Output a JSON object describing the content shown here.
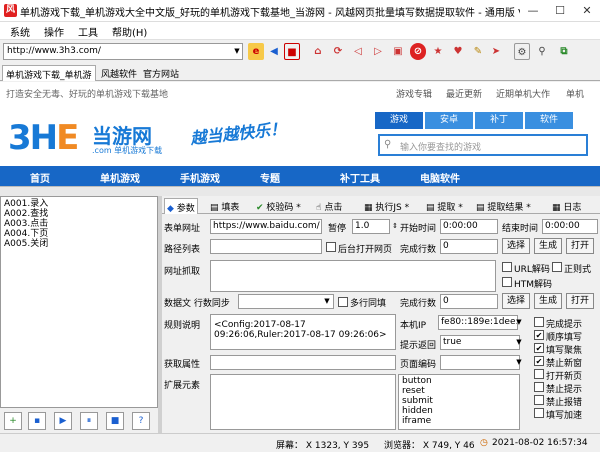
{
  "window": {
    "title": "单机游戏下载_单机游戏大全中文版_好玩的单机游戏下载基地_当游网 - 风越网页批量填写数据提取软件 - 通用版 V..."
  },
  "menu": [
    "系统",
    "操作",
    "工具",
    "帮助(H)"
  ],
  "toolbar": {
    "url": "http://www.3h3.com/"
  },
  "tabs": [
    "单机游戏下载_单机游",
    "风越软件",
    "官方网站"
  ],
  "browser": {
    "slogan": "打造安全无毒、好玩的单机游戏下载基地",
    "toplinks": [
      "游戏专辑",
      "最近更新",
      "近期单机大作",
      "单机"
    ],
    "logo_3": "3H",
    "logo_e": "E",
    "logo_text": "当游网",
    "logo_domain": ".com 单机游戏下载",
    "slogan2": "越当越快乐！",
    "search_tabs": [
      "游戏",
      "安卓",
      "补丁",
      "软件"
    ],
    "search_placeholder": "输入你要查找的游戏",
    "nav": [
      "首页",
      "单机游戏",
      "手机游戏",
      "专题",
      "补丁工具",
      "电脑软件"
    ]
  },
  "left_list": [
    "A001.录入",
    "A002.查找",
    "A003.点击",
    "A004.下页",
    "A005.关闭"
  ],
  "right_tabs": [
    "参数",
    "填表",
    "校验码",
    "点击",
    "执行JS",
    "提取",
    "提取结果",
    "日志"
  ],
  "form": {
    "form_url_label": "表单网址",
    "form_url": "https://www.baidu.com/",
    "pause_label": "暂停",
    "pause": "1.0",
    "start_label": "开始时间",
    "start_time": "0:00:00",
    "end_label": "结束时间",
    "end_time": "0:00:00",
    "path_label": "路径列表",
    "bg_open": "后台打开网页",
    "done_rows_label": "完成行数",
    "done_rows": "0",
    "select": "选择",
    "generate": "生成",
    "open": "打开",
    "url_grab_label": "网址抓取",
    "url_decode": "URL解码",
    "regex": "正则式",
    "html_decode": "HTM解码",
    "data_label": "数据文 行数同步",
    "multiline": "多行同填",
    "rule_label": "规则说明",
    "rule_text": "<Config:2017-08-17 09:26:06,Ruler:2017-08-17 09:26:06>",
    "ip_label": "本机IP",
    "ip": "fe80::189e:1dee:",
    "hint_label": "提示返回",
    "hint": "true",
    "get_attr_label": "获取属性",
    "page_enc_label": "页面编码",
    "ext_label": "扩展元素",
    "elements": [
      "button",
      "reset",
      "submit",
      "hidden",
      "iframe"
    ],
    "checks": [
      {
        "label": "完成提示",
        "checked": false
      },
      {
        "label": "顺序填写",
        "checked": true
      },
      {
        "label": "填写聚焦",
        "checked": true
      },
      {
        "label": "禁止新窗",
        "checked": true
      },
      {
        "label": "打开新页",
        "checked": false
      },
      {
        "label": "禁止提示",
        "checked": false
      },
      {
        "label": "禁止报错",
        "checked": false
      },
      {
        "label": "填写加速",
        "checked": false
      }
    ]
  },
  "status": {
    "screen": "屏幕： X 1323, Y 395",
    "browser": "浏览器： X 749, Y 46",
    "datetime": "2021-08-02 16:57:34"
  }
}
